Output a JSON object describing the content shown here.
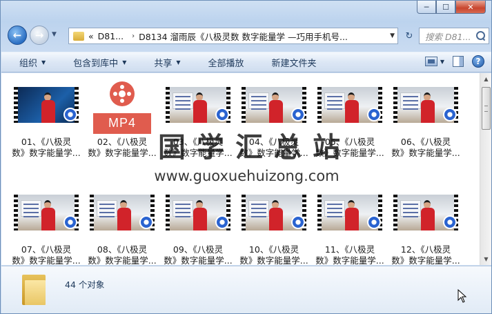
{
  "window": {
    "caption": {
      "minimize": "─",
      "maximize": "☐",
      "close": "✕"
    }
  },
  "nav": {
    "breadcrumb": [
      "«",
      "D81...",
      "D8134 溜雨辰《八极灵数 数字能量学 —巧用手机号..."
    ],
    "breadcrumb_sep": "›",
    "search_placeholder": "搜索 D81..."
  },
  "toolbar": {
    "commands": [
      "组织",
      "包含到库中",
      "共享",
      "全部播放",
      "新建文件夹"
    ]
  },
  "files": [
    {
      "line1": "01、《八极灵",
      "line2": "数》数字能量学...",
      "kind": "dark"
    },
    {
      "line1": "02、《八极灵",
      "line2": "数》数字能量学...",
      "kind": "mp4",
      "badge": "MP4"
    },
    {
      "line1": "03、《八极灵",
      "line2": "数》数字能量学...",
      "kind": "video"
    },
    {
      "line1": "04、《八极灵",
      "line2": "数》数字能量学...",
      "kind": "video"
    },
    {
      "line1": "05、《八极灵",
      "line2": "数》数字能量学...",
      "kind": "video"
    },
    {
      "line1": "06、《八极灵",
      "line2": "数》数字能量学...",
      "kind": "video"
    },
    {
      "line1": "07、《八极灵",
      "line2": "数》数字能量学...",
      "kind": "video"
    },
    {
      "line1": "08、《八极灵",
      "line2": "数》数字能量学...",
      "kind": "video"
    },
    {
      "line1": "09、《八极灵",
      "line2": "数》数字能量学...",
      "kind": "video"
    },
    {
      "line1": "10、《八极灵",
      "line2": "数》数字能量学...",
      "kind": "video"
    },
    {
      "line1": "11、《八极灵",
      "line2": "数》数字能量学...",
      "kind": "video"
    },
    {
      "line1": "12、《八极灵",
      "line2": "数》数字能量学...",
      "kind": "video"
    }
  ],
  "watermark": {
    "title": "国学汇总站",
    "url": "www.guoxuehuizong.com"
  },
  "details": {
    "count": "44 个对象"
  }
}
